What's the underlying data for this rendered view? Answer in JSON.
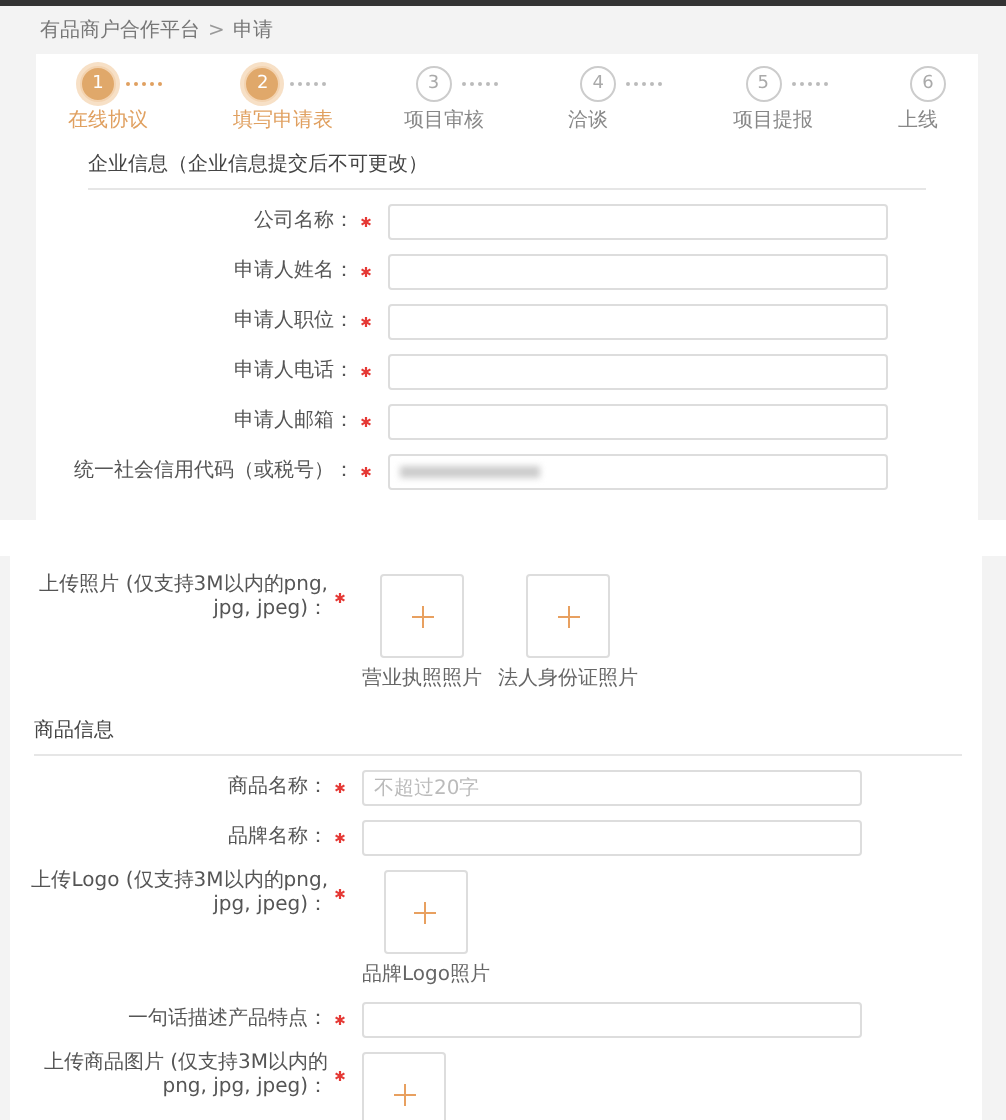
{
  "breadcrumb": {
    "items": [
      "有品商户合作平台",
      "申请"
    ],
    "separator": ">"
  },
  "steps": [
    {
      "number": "1",
      "label": "在线协议",
      "active": true
    },
    {
      "number": "2",
      "label": "填写申请表",
      "active": true
    },
    {
      "number": "3",
      "label": "项目审核",
      "active": false
    },
    {
      "number": "4",
      "label": "洽谈",
      "active": false
    },
    {
      "number": "5",
      "label": "项目提报",
      "active": false
    },
    {
      "number": "6",
      "label": "上线",
      "active": false
    }
  ],
  "company_section": {
    "title": "企业信息（企业信息提交后不可更改）",
    "fields": [
      {
        "kind": "text",
        "label": "公司名称：",
        "required": true
      },
      {
        "kind": "text",
        "label": "申请人姓名：",
        "required": true
      },
      {
        "kind": "text",
        "label": "申请人职位：",
        "required": true
      },
      {
        "kind": "text",
        "label": "申请人电话：",
        "required": true
      },
      {
        "kind": "text",
        "label": "申请人邮箱：",
        "required": true
      },
      {
        "kind": "text",
        "label": "统一社会信用代码（或税号）：",
        "required": true,
        "redacted": true
      }
    ]
  },
  "photo_fields": [
    {
      "kind": "upload",
      "label": "上传照片 (仅支持3M以内的png, jpg, jpeg)：",
      "required": true,
      "tiles": [
        {
          "kind": "upload",
          "caption": "营业执照照片"
        },
        {
          "kind": "upload",
          "caption": "法人身份证照片"
        }
      ]
    }
  ],
  "product_section": {
    "title": "商品信息",
    "fields": [
      {
        "kind": "text",
        "label": "商品名称：",
        "required": true,
        "placeholder": "不超过20字"
      },
      {
        "kind": "text",
        "label": "品牌名称：",
        "required": true
      },
      {
        "kind": "upload",
        "label": "上传Logo (仅支持3M以内的png, jpg, jpeg)：",
        "required": true,
        "tiles": [
          {
            "kind": "upload",
            "caption": "品牌Logo照片"
          }
        ]
      },
      {
        "kind": "text",
        "label": "一句话描述产品特点：",
        "required": true
      },
      {
        "kind": "upload",
        "label": "上传商品图片 (仅支持3M以内的png, jpg, jpeg)：",
        "required": true,
        "tiles": [
          {
            "kind": "upload"
          }
        ]
      }
    ]
  }
}
